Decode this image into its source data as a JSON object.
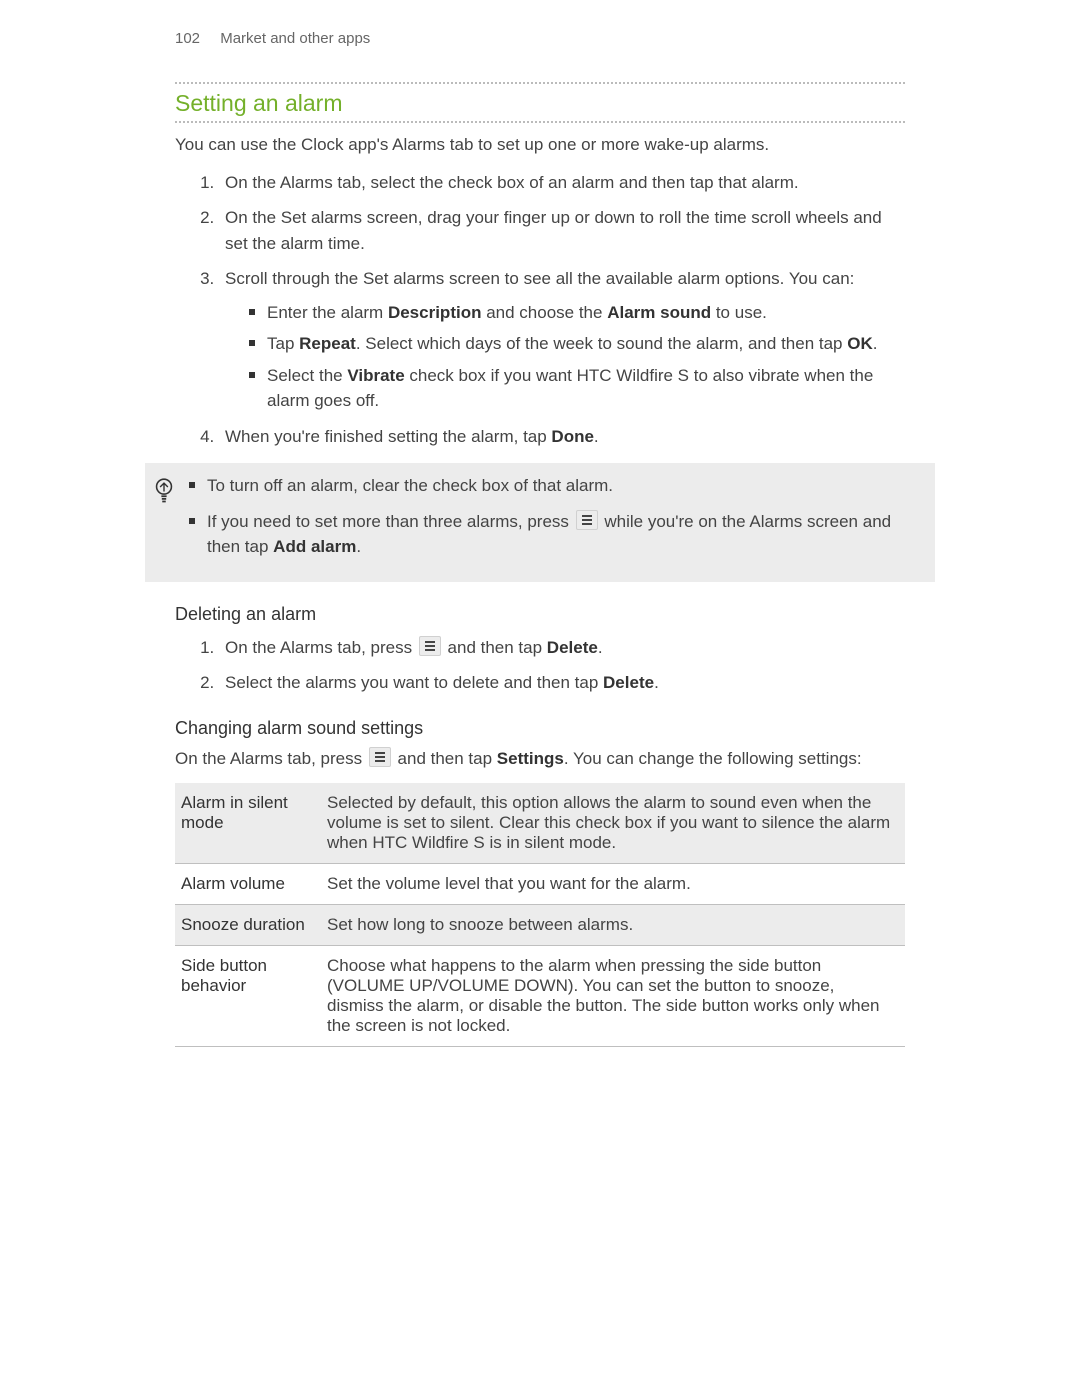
{
  "header": {
    "page_number": "102",
    "chapter": "Market and other apps"
  },
  "section_title": "Setting an alarm",
  "intro": "You can use the Clock app's Alarms tab to set up one or more wake-up alarms.",
  "steps": [
    {
      "text": "On the Alarms tab, select the check box of an alarm and then tap that alarm."
    },
    {
      "text": "On the Set alarms screen, drag your finger up or down to roll the time scroll wheels and set the alarm time."
    },
    {
      "text": "Scroll through the Set alarms screen to see all the available alarm options. You can:",
      "sub": [
        {
          "pre": "Enter the alarm ",
          "b1": "Description",
          "mid": " and choose the ",
          "b2": "Alarm sound",
          "post": " to use."
        },
        {
          "pre": "Tap ",
          "b1": "Repeat",
          "mid": ". Select which days of the week to sound the alarm, and then tap ",
          "b2": "OK",
          "post": "."
        },
        {
          "pre": "Select the ",
          "b1": "Vibrate",
          "mid": " check box if you want HTC Wildfire S to also vibrate when the alarm goes off.",
          "b2": "",
          "post": ""
        }
      ]
    },
    {
      "pre": "When you're finished setting the alarm, tap ",
      "b1": "Done",
      "post": "."
    }
  ],
  "tip": {
    "items": [
      {
        "text": "To turn off an alarm, clear the check box of that alarm."
      },
      {
        "pre": "If you need to set more than three alarms, press ",
        "mid": " while you're on the Alarms screen and then tap ",
        "b1": "Add alarm",
        "post": "."
      }
    ]
  },
  "deleting": {
    "heading": "Deleting an alarm",
    "steps": [
      {
        "pre": "On the Alarms tab, press ",
        "mid": " and then tap ",
        "b1": "Delete",
        "post": "."
      },
      {
        "pre": "Select the alarms you want to delete and then tap ",
        "b1": "Delete",
        "post": "."
      }
    ]
  },
  "changing": {
    "heading": "Changing alarm sound settings",
    "intro_pre": "On the Alarms tab, press ",
    "intro_mid": " and then tap ",
    "intro_b": "Settings",
    "intro_post": ". You can change the following settings:",
    "rows": [
      {
        "name": "Alarm in silent mode",
        "desc": "Selected by default, this option allows the alarm to sound even when the volume is set to silent. Clear this check box if you want to silence the alarm when HTC Wildfire S is in silent mode."
      },
      {
        "name": "Alarm volume",
        "desc": "Set the volume level that you want for the alarm."
      },
      {
        "name": "Snooze duration",
        "desc": "Set how long to snooze between alarms."
      },
      {
        "name": "Side button behavior",
        "desc": "Choose what happens to the alarm when pressing the side button (VOLUME UP/VOLUME DOWN). You can set the button to snooze, dismiss the alarm, or disable the button. The side button works only when the screen is not locked."
      }
    ]
  }
}
